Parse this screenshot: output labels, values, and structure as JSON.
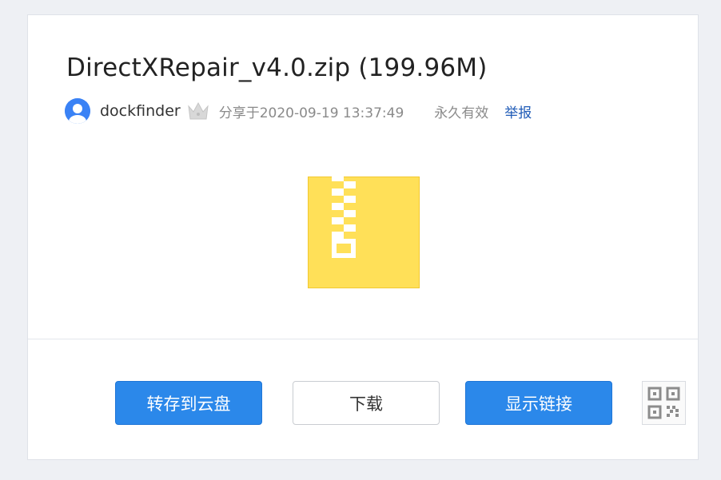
{
  "file": {
    "title": "DirectXRepair_v4.0.zip (199.96M)",
    "icon": "zip-file-icon"
  },
  "sharer": {
    "username": "dockfinder",
    "avatar_icon": "user-avatar-icon",
    "badge_icon": "crown-icon",
    "share_time": "分享于2020-09-19 13:37:49",
    "validity": "永久有效",
    "report_label": "举报"
  },
  "actions": {
    "save_label": "转存到云盘",
    "download_label": "下载",
    "show_link_label": "显示链接",
    "qr_icon": "qr-code-icon"
  },
  "colors": {
    "primary": "#2b88ea",
    "link": "#1f5bb7",
    "zip_yellow": "#ffe058"
  }
}
